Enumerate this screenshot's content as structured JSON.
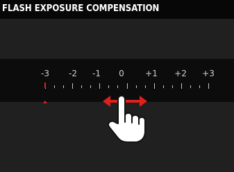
{
  "screen": {
    "title": "FLASH EXPOSURE COMPENSATION"
  },
  "scale": {
    "labels": [
      "-3",
      "-2",
      "-1",
      "0",
      "+1",
      "+2",
      "+3"
    ],
    "value_min": -3,
    "value_max": 3,
    "current_value": -3,
    "marker_color": "#e02020"
  },
  "gesture": {
    "icon": "swipe-horizontal-hand-icon",
    "arrow_color": "#e0201a"
  }
}
